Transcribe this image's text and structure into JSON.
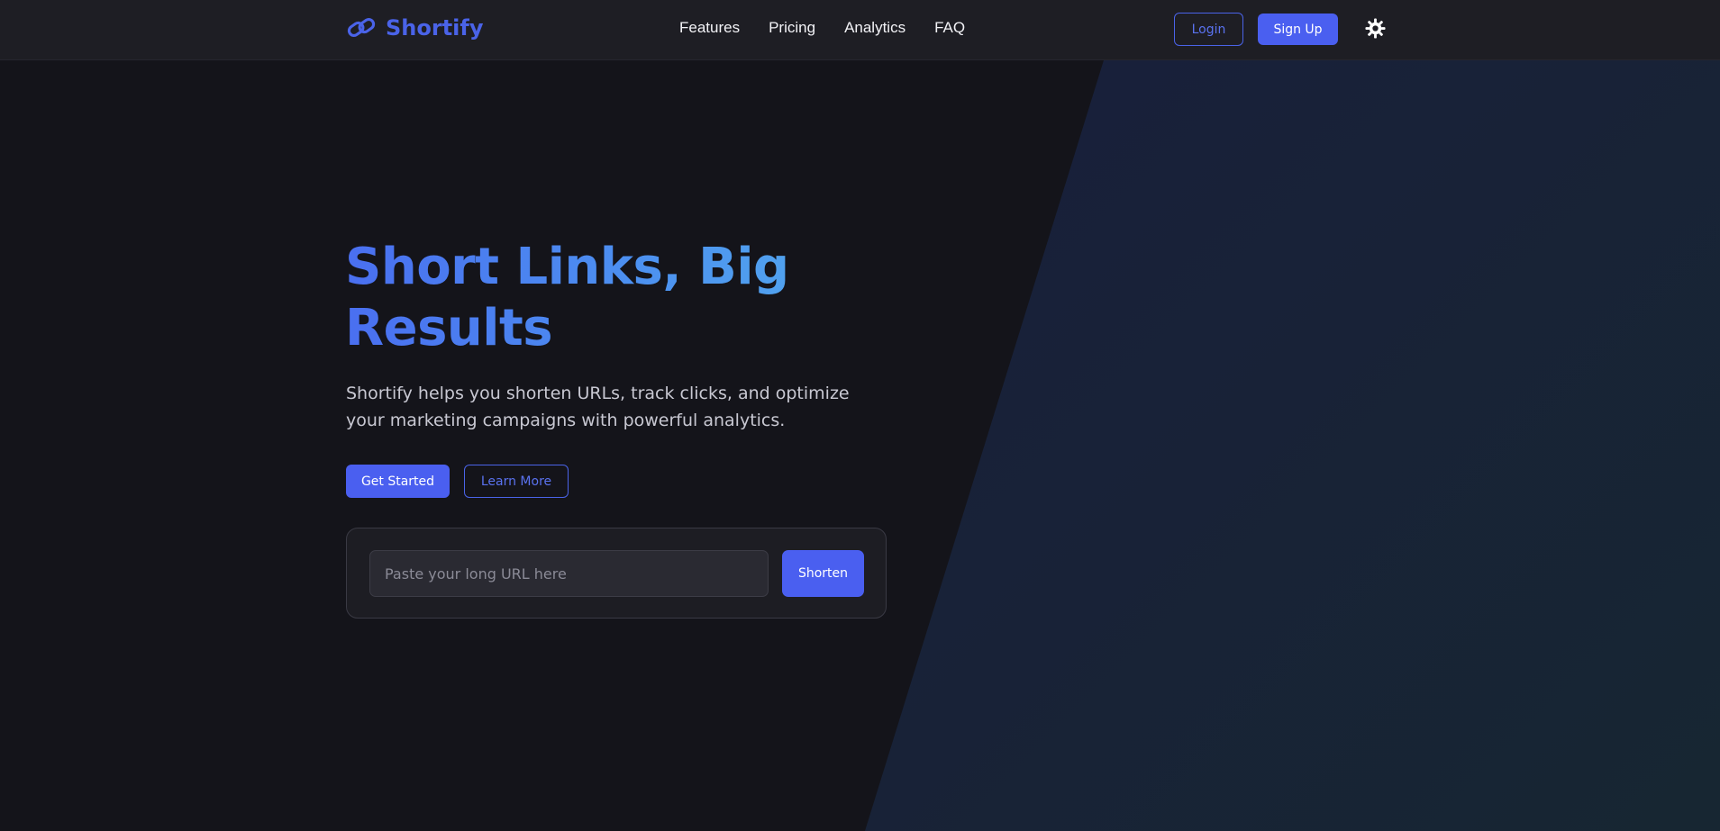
{
  "colors": {
    "accent": "#4a5ff0",
    "page_background": "#14141a",
    "header_background": "#1e1e24"
  },
  "header": {
    "logo_text": "Shortify",
    "logo_icon": "link-icon",
    "nav": [
      "Features",
      "Pricing",
      "Analytics",
      "FAQ"
    ],
    "login_label": "Login",
    "signup_label": "Sign Up",
    "theme_icon": "sun-icon"
  },
  "hero": {
    "title": "Short Links, Big Results",
    "subtitle": "Shortify helps you shorten URLs, track clicks, and optimize your marketing campaigns with powerful analytics.",
    "primary_button": "Get Started",
    "secondary_button": "Learn More"
  },
  "shortener": {
    "input_placeholder": "Paste your long URL here",
    "input_value": "",
    "button_label": "Shorten"
  }
}
